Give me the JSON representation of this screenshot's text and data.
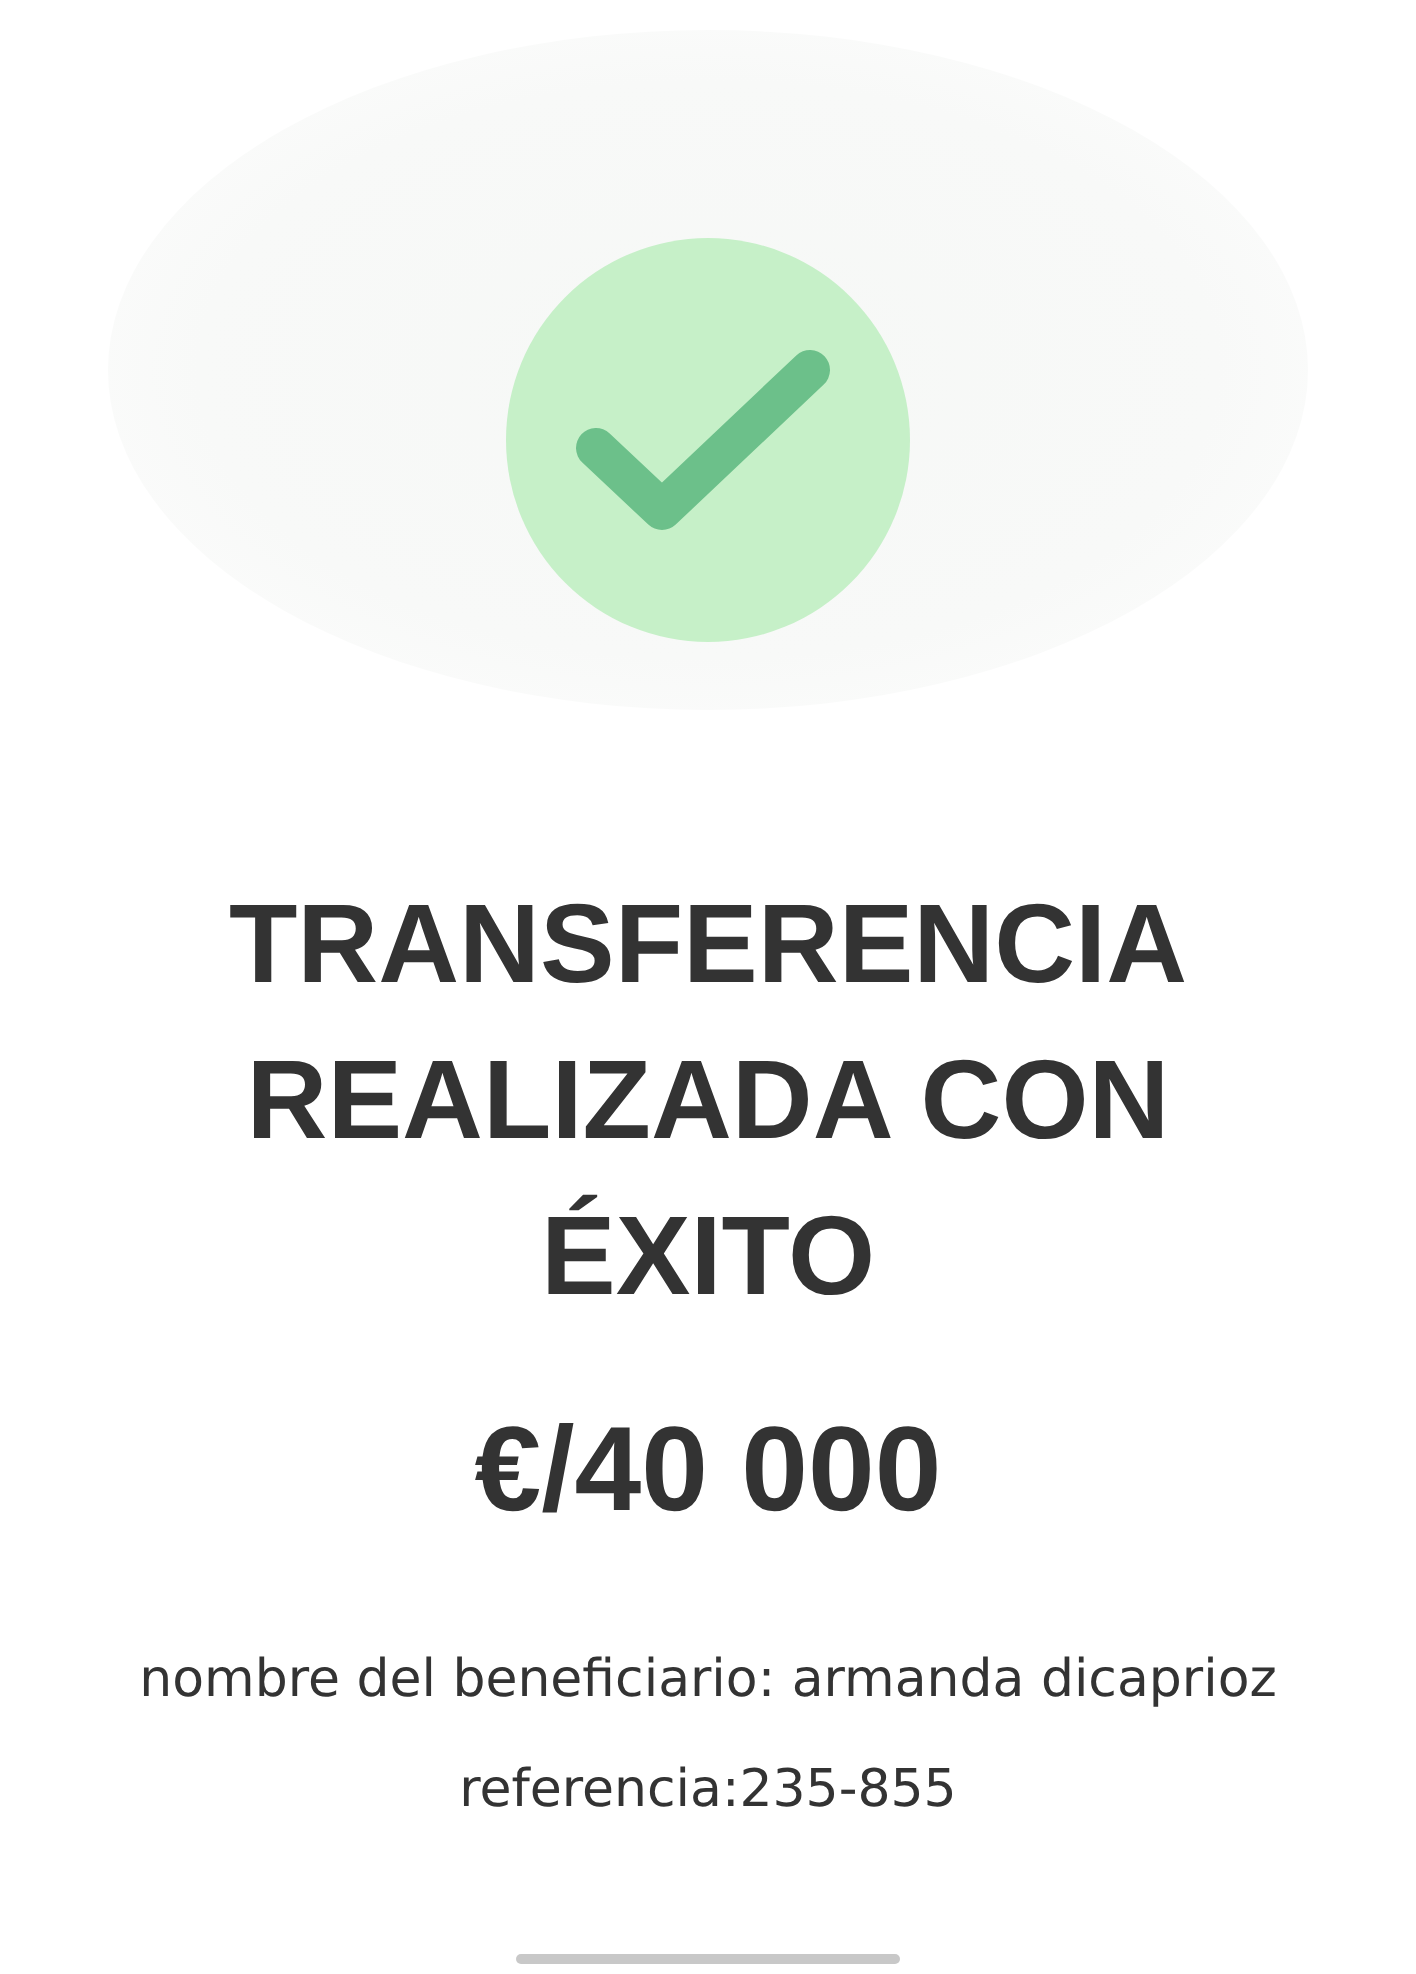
{
  "title": "TRANSFERENCIA REALIZADA CON ÉXITO",
  "amount": "€/40 000",
  "details": [
    "nombre del beneficiario: armanda dicaprioz",
    "referencia:235-855"
  ]
}
